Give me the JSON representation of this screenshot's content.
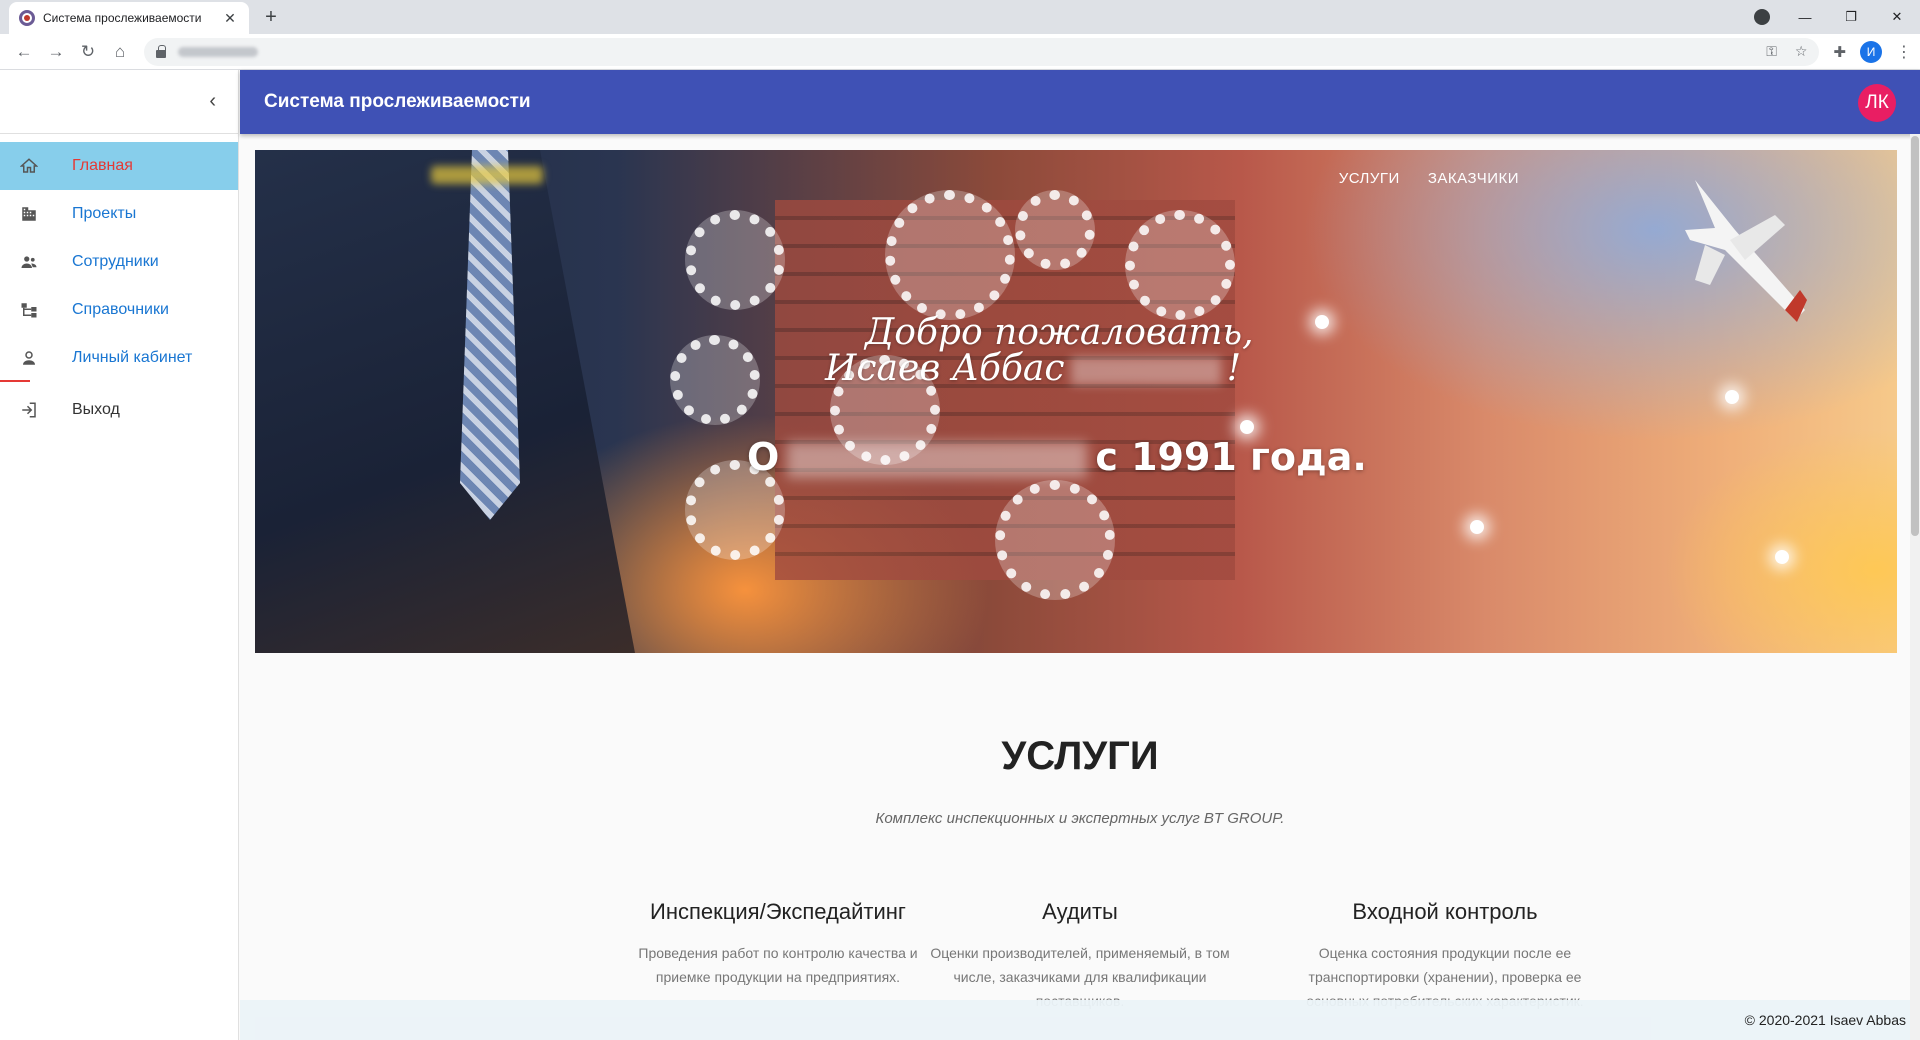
{
  "browser": {
    "tab_title": "Система прослеживаемости",
    "tab_close": "✕",
    "new_tab": "+",
    "profile_initial": "И"
  },
  "sidebar": {
    "collapse_icon": "chevron-left-icon",
    "items": [
      {
        "label": "Главная",
        "icon": "home-icon"
      },
      {
        "label": "Проекты",
        "icon": "buildings-icon"
      },
      {
        "label": "Сотрудники",
        "icon": "people-icon"
      },
      {
        "label": "Справочники",
        "icon": "hierarchy-icon"
      },
      {
        "label": "Личный кабинет",
        "icon": "person-icon"
      },
      {
        "label": "Выход",
        "icon": "logout-icon"
      }
    ]
  },
  "header": {
    "title": "Система прослеживаемости",
    "avatar": "ЛК"
  },
  "hero": {
    "nav": [
      "УСЛУГИ",
      "ЗАКАЗЧИКИ"
    ],
    "welcome_line1": "Добро пожаловать,",
    "welcome_line2_start": "Исаев Аббас",
    "welcome_line2_end": "!",
    "since_start": "О",
    "since_end": "с 1991 года."
  },
  "services": {
    "title": "УСЛУГИ",
    "subtitle": "Комплекс инспекционных и экспертных услуг BT GROUP.",
    "items": [
      {
        "title": "Инспекция/Экспедайтинг",
        "text": "Проведения работ по контролю качества и приемке продукции на предприятиях."
      },
      {
        "title": "Аудиты",
        "text": "Оценки производителей, применяемый, в том числе, заказчиками для квалификации поставщиков."
      },
      {
        "title": "Входной контроль",
        "text": "Оценка состояния продукции после ее транспортировки (хранении), проверка ее основных потребительских характеристик."
      }
    ]
  },
  "footer": {
    "copyright": "© 2020-2021 Isaev Abbas"
  },
  "colors": {
    "appbar": "#3f51b5",
    "active_item_bg": "#87ceeb",
    "active_item_text": "#e53935",
    "nav_link": "#1976d2",
    "avatar": "#e91e63"
  }
}
